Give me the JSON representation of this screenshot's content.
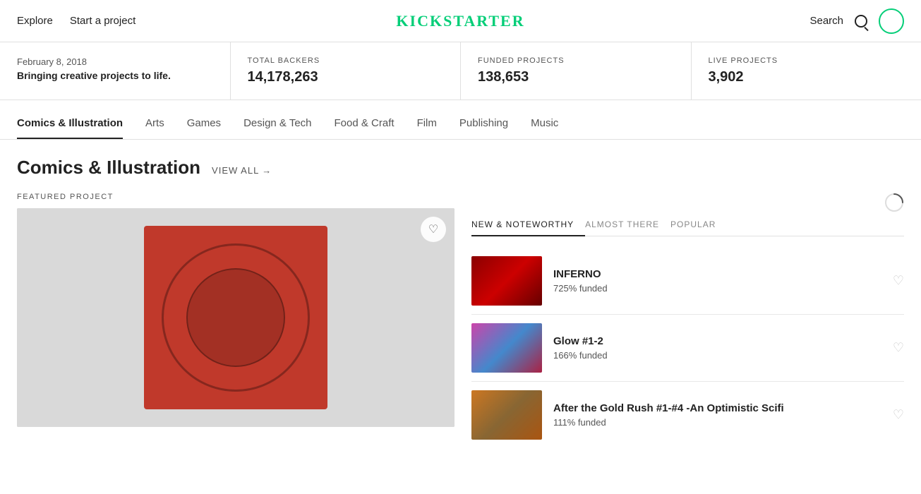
{
  "nav": {
    "explore": "Explore",
    "start_project": "Start a project",
    "logo": "KICKSTARTER",
    "search": "Search"
  },
  "stats": {
    "date": "February 8, 2018",
    "tagline": "Bringing creative projects to life.",
    "total_backers_label": "TOTAL BACKERS",
    "total_backers_value": "14,178,263",
    "funded_projects_label": "FUNDED PROJECTS",
    "funded_projects_value": "138,653",
    "live_projects_label": "LIVE PROJECTS",
    "live_projects_value": "3,902"
  },
  "category_tabs": [
    {
      "label": "Comics & Illustration",
      "active": true
    },
    {
      "label": "Arts",
      "active": false
    },
    {
      "label": "Games",
      "active": false
    },
    {
      "label": "Design & Tech",
      "active": false
    },
    {
      "label": "Food & Craft",
      "active": false
    },
    {
      "label": "Film",
      "active": false
    },
    {
      "label": "Publishing",
      "active": false
    },
    {
      "label": "Music",
      "active": false
    }
  ],
  "section": {
    "title": "Comics & Illustration",
    "view_all": "VIEW ALL",
    "view_all_arrow": "→"
  },
  "featured": {
    "label": "FEATURED PROJECT"
  },
  "sub_tabs": [
    {
      "label": "NEW & NOTEWORTHY",
      "active": true
    },
    {
      "label": "ALMOST THERE",
      "active": false
    },
    {
      "label": "POPULAR",
      "active": false
    }
  ],
  "projects": [
    {
      "name": "INFERNO",
      "funded": "725% funded",
      "thumb_type": "inferno"
    },
    {
      "name": "Glow #1-2",
      "funded": "166% funded",
      "thumb_type": "glow"
    },
    {
      "name": "After the Gold Rush #1-#4 -An Optimistic Scifi",
      "funded": "111% funded",
      "thumb_type": "rush"
    }
  ]
}
